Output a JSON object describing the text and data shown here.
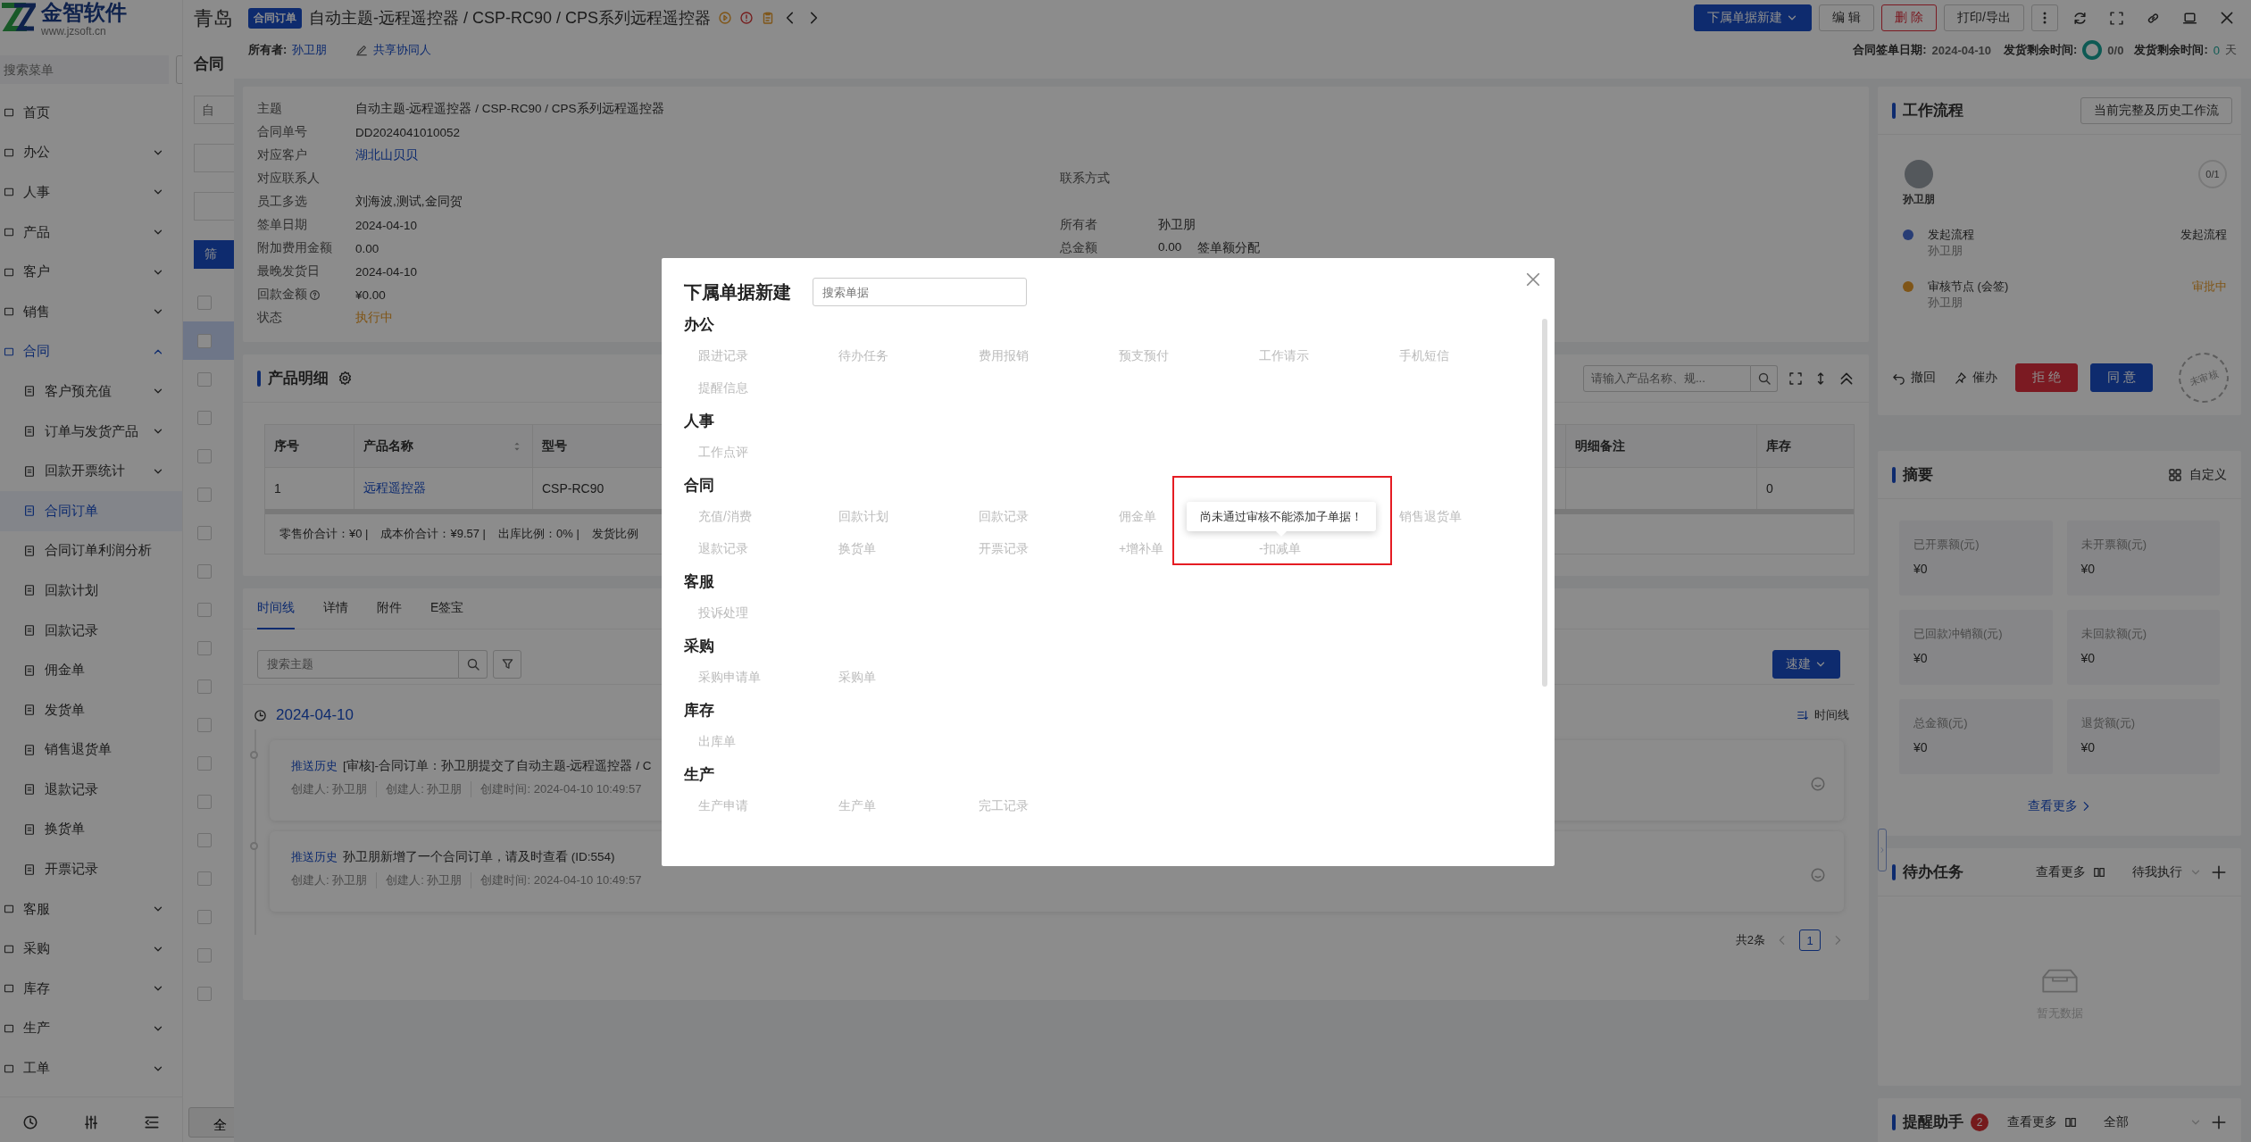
{
  "sidebar": {
    "logo_name": "金智软件",
    "logo_url": "www.jzsoft.cn",
    "search": {
      "placeholder": "搜索菜单"
    },
    "items": [
      {
        "label": "首页",
        "kind": "link",
        "selected": false
      },
      {
        "label": "办公",
        "kind": "group",
        "expanded": false,
        "selected": false
      },
      {
        "label": "人事",
        "kind": "group",
        "expanded": false,
        "selected": false
      },
      {
        "label": "产品",
        "kind": "group",
        "expanded": false,
        "selected": false
      },
      {
        "label": "客户",
        "kind": "group",
        "expanded": false,
        "selected": false
      },
      {
        "label": "销售",
        "kind": "group",
        "expanded": false,
        "selected": false
      },
      {
        "label": "合同",
        "kind": "group",
        "expanded": true,
        "selected": true,
        "children": [
          {
            "label": "客户预充值",
            "kind": "group",
            "expanded": false,
            "selected": false
          },
          {
            "label": "订单与发货产品",
            "kind": "group",
            "expanded": false,
            "selected": false
          },
          {
            "label": "回款开票统计",
            "kind": "group",
            "expanded": false,
            "selected": false
          },
          {
            "label": "合同订单",
            "kind": "link",
            "selected": true
          },
          {
            "label": "合同订单利润分析",
            "kind": "link",
            "selected": false
          },
          {
            "label": "回款计划",
            "kind": "link",
            "selected": false
          },
          {
            "label": "回款记录",
            "kind": "link",
            "selected": false
          },
          {
            "label": "佣金单",
            "kind": "link",
            "selected": false
          },
          {
            "label": "发货单",
            "kind": "link",
            "selected": false
          },
          {
            "label": "销售退货单",
            "kind": "link",
            "selected": false
          },
          {
            "label": "退款记录",
            "kind": "link",
            "selected": false
          },
          {
            "label": "换货单",
            "kind": "link",
            "selected": false
          },
          {
            "label": "开票记录",
            "kind": "link",
            "selected": false
          }
        ]
      },
      {
        "label": "客服",
        "kind": "group",
        "expanded": false,
        "selected": false
      },
      {
        "label": "采购",
        "kind": "group",
        "expanded": false,
        "selected": false
      },
      {
        "label": "库存",
        "kind": "group",
        "expanded": false,
        "selected": false
      },
      {
        "label": "生产",
        "kind": "group",
        "expanded": false,
        "selected": false
      },
      {
        "label": "工单",
        "kind": "group",
        "expanded": false,
        "selected": false
      }
    ]
  },
  "list_page": {
    "title": "青岛",
    "heading": "合同",
    "filter": {
      "placeholder": "自"
    },
    "filter_button": "筛",
    "footer": "全",
    "rows": [
      {
        "checked": false,
        "selected": false
      },
      {
        "checked": false,
        "selected": true
      },
      {
        "checked": false,
        "selected": false
      },
      {
        "checked": false,
        "selected": false
      },
      {
        "checked": false,
        "selected": false
      },
      {
        "checked": false,
        "selected": false
      },
      {
        "checked": false,
        "selected": false
      },
      {
        "checked": false,
        "selected": false
      },
      {
        "checked": false,
        "selected": false
      },
      {
        "checked": false,
        "selected": false
      },
      {
        "checked": false,
        "selected": false
      },
      {
        "checked": false,
        "selected": false
      },
      {
        "checked": false,
        "selected": false
      },
      {
        "checked": false,
        "selected": false
      },
      {
        "checked": false,
        "selected": false
      },
      {
        "checked": false,
        "selected": false
      },
      {
        "checked": false,
        "selected": false
      },
      {
        "checked": false,
        "selected": false
      },
      {
        "checked": false,
        "selected": false
      }
    ]
  },
  "record": {
    "tag": "合同订单",
    "title": "自动主题-远程遥控器 / CSP-RC90 / CPS系列远程遥控器",
    "owner_label": "所有者:",
    "owner": "孙卫朋",
    "share": "共享协同人",
    "actions": [
      {
        "label": "下属单据新建",
        "kind": "primary"
      },
      {
        "label": "编 辑",
        "kind": "default"
      },
      {
        "label": "删 除",
        "kind": "danger"
      },
      {
        "label": "打印/导出",
        "kind": "default"
      }
    ],
    "sign_label": "合同签单日期:",
    "sign_date": "2024-04-10",
    "ship_label": "发货剩余时间:",
    "ship_count": "0/0",
    "remain_label": "发货剩余时间:",
    "remain_value": "0",
    "remain_unit": "天"
  },
  "info": {
    "rows": [
      {
        "label": "主题",
        "value": "自动主题-远程遥控器 / CSP-RC90 / CPS系列远程遥控器",
        "kind": "text"
      },
      {
        "label": "合同单号",
        "value": "DD2024041010052",
        "kind": "text"
      },
      {
        "label": "对应客户",
        "value": "湖北山贝贝",
        "kind": "link"
      },
      {
        "label": "对应联系人",
        "kind": "text",
        "right": {
          "label": "联系方式"
        }
      },
      {
        "label": "员工多选",
        "value": "刘海波,测试,金同贺",
        "kind": "text"
      },
      {
        "label": "签单日期",
        "value": "2024-04-10",
        "kind": "text",
        "right": {
          "label": "所有者",
          "value": "孙卫朋"
        }
      },
      {
        "label": "附加费用金额",
        "value": "0.00",
        "kind": "text",
        "right": {
          "label": "总金额",
          "value": "0.00",
          "action": "签单额分配"
        }
      },
      {
        "label": "最晚发货日",
        "value": "2024-04-10",
        "kind": "text"
      },
      {
        "label": "回款金额",
        "value": "¥0.00",
        "kind": "text",
        "help": true
      },
      {
        "label": "状态",
        "value": "执行中",
        "kind": "status"
      }
    ]
  },
  "products": {
    "title": "产品明细",
    "search": {
      "placeholder": "请输入产品名称、规..."
    },
    "columns": [
      {
        "label": "序号",
        "sortable": false
      },
      {
        "label": "产品名称",
        "sortable": true
      },
      {
        "label": "型号"
      },
      {
        "label": "明细备注",
        "sortable": false
      },
      {
        "label": "库存",
        "sortable": false
      }
    ],
    "rows": [
      {
        "cells": [
          "1",
          "远程遥控器",
          "CSP-RC90",
          "",
          "0"
        ]
      }
    ],
    "summary": [
      "零售价合计：¥0 |",
      "成本价合计：¥9.57 |",
      "出库比例：0% |",
      "发货比例"
    ]
  },
  "activity": {
    "tabs": [
      {
        "label": "时间线",
        "selected": true
      },
      {
        "label": "详情",
        "selected": false
      },
      {
        "label": "附件",
        "selected": false
      },
      {
        "label": "E签宝",
        "selected": false
      }
    ],
    "search": {
      "placeholder": "搜索主题"
    },
    "quick_button": "速建",
    "date": "2024-04-10",
    "order": "时间线",
    "entries": [
      {
        "source": "推送历史",
        "text": "[审核]-合同订单：孙卫朋提交了自动主题-远程遥控器 / C",
        "meta": [
          "创建人: 孙卫朋",
          "创建人: 孙卫朋",
          "创建时间: 2024-04-10 10:49:57"
        ]
      },
      {
        "source": "推送历史",
        "text": "孙卫朋新增了一个合同订单，请及时查看 (ID:554)",
        "meta": [
          "创建人: 孙卫朋",
          "创建人: 孙卫朋",
          "创建时间: 2024-04-10 10:49:57"
        ]
      }
    ],
    "total": "共2条",
    "page": "1"
  },
  "workflow": {
    "title": "工作流程",
    "history_button": "当前完整及历史工作流",
    "user": "孙卫朋",
    "count": "0/1",
    "steps": [
      {
        "title": "发起流程",
        "person": "孙卫朋",
        "status": "发起流程",
        "kind": "start"
      },
      {
        "title": "审核节点 (会签)",
        "person": "孙卫朋",
        "status": "审批中",
        "kind": "review"
      }
    ],
    "stamp": "未审核",
    "actions": [
      {
        "label": "撤回",
        "kind": "undo"
      },
      {
        "label": "催办",
        "kind": "pin"
      },
      {
        "label": "拒 绝",
        "kind": "danger"
      },
      {
        "label": "同 意",
        "kind": "primary"
      }
    ]
  },
  "summary": {
    "title": "摘要",
    "customize": "自定义",
    "tiles": [
      {
        "label": "已开票额(元)",
        "value": "¥0"
      },
      {
        "label": "未开票额(元)",
        "value": "¥0"
      },
      {
        "label": "已回款冲销额(元)",
        "value": "¥0"
      },
      {
        "label": "未回款额(元)",
        "value": "¥0"
      },
      {
        "label": "总金额(元)",
        "value": "¥0"
      },
      {
        "label": "退货额(元)",
        "value": "¥0"
      }
    ],
    "more": "查看更多"
  },
  "todo": {
    "title": "待办任务",
    "more": "查看更多",
    "filter": "待我执行",
    "empty": "暂无数据"
  },
  "reminder": {
    "title": "提醒助手",
    "badge": "2",
    "more": "查看更多",
    "filter": "全部"
  },
  "modal": {
    "title": "下属单据新建",
    "search": {
      "placeholder": "搜索单据"
    },
    "sections": [
      {
        "title": "办公",
        "items": [
          {
            "label": "跟进记录"
          },
          {
            "label": "待办任务"
          },
          {
            "label": "费用报销"
          },
          {
            "label": "预支预付"
          },
          {
            "label": "工作请示"
          },
          {
            "label": "手机短信"
          },
          {
            "label": "提醒信息"
          }
        ]
      },
      {
        "title": "人事",
        "items": [
          {
            "label": "工作点评"
          }
        ]
      },
      {
        "title": "合同",
        "items": [
          {
            "label": "充值/消费"
          },
          {
            "label": "回款计划"
          },
          {
            "label": "回款记录"
          },
          {
            "label": "佣金单",
            "kind": "item"
          },
          {
            "kind": "tooltip",
            "label": "尚未通过审核不能添加子单据！"
          },
          {
            "label": "销售退货单",
            "kind": "item"
          },
          {
            "label": "退款记录",
            "kind": "item"
          },
          {
            "label": "换货单",
            "kind": "item"
          },
          {
            "label": "开票记录",
            "kind": "item"
          },
          {
            "label": "+增补单",
            "kind": "item"
          },
          {
            "label": "-扣减单",
            "kind": "item",
            "highlighted": true
          }
        ]
      },
      {
        "title": "客服",
        "items": [
          {
            "label": "投诉处理"
          }
        ]
      },
      {
        "title": "采购",
        "items": [
          {
            "label": "采购申请单"
          },
          {
            "label": "采购单"
          }
        ]
      },
      {
        "title": "库存",
        "items": [
          {
            "label": "出库单"
          }
        ]
      },
      {
        "title": "生产",
        "items": [
          {
            "label": "生产申请"
          },
          {
            "label": "生产单"
          },
          {
            "label": "完工记录"
          }
        ]
      }
    ]
  }
}
